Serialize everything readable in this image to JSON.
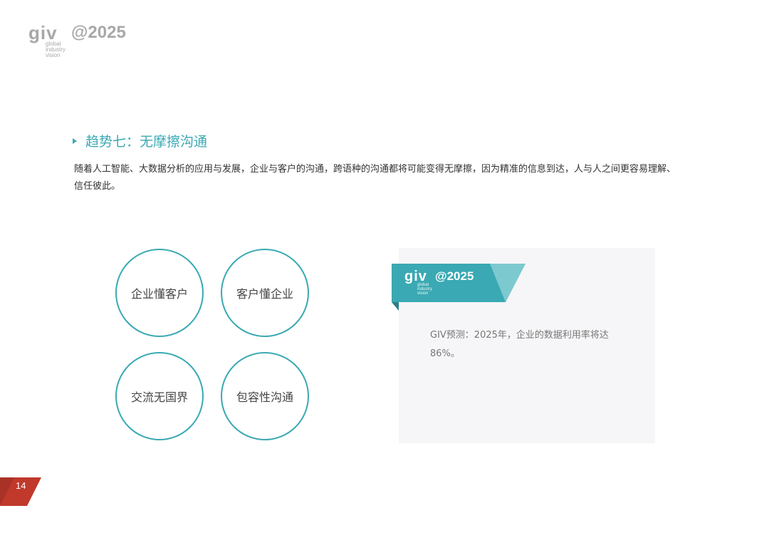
{
  "header": {
    "logo_mark": "giv",
    "logo_sub_lines": [
      "global",
      "industry",
      "vision"
    ],
    "logo_year": "@2025"
  },
  "section": {
    "title": "趋势七：无摩擦沟通",
    "body": "随着人工智能、大数据分析的应用与发展，企业与客户的沟通，跨语种的沟通都将可能变得无摩擦，因为精准的信息到达，人与人之间更容易理解、信任彼此。"
  },
  "circles": [
    {
      "label": "企业懂客户"
    },
    {
      "label": "客户懂企业"
    },
    {
      "label": "交流无国界"
    },
    {
      "label": "包容性沟通"
    }
  ],
  "card": {
    "ribbon_logo_mark": "giv",
    "ribbon_logo_sub": [
      "global",
      "industry",
      "vision"
    ],
    "ribbon_year": "@2025",
    "text": "GIV预测：2025年，企业的数据利用率将达86%。"
  },
  "footer": {
    "page_number": "14"
  },
  "colors": {
    "accent": "#3aa9b3",
    "page_badge": "#c0392b",
    "logo_gray": "#a8a8a8"
  }
}
